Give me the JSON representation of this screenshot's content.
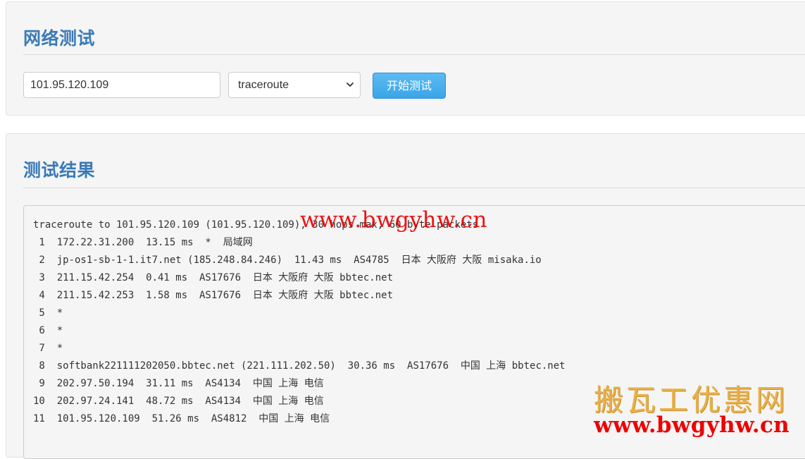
{
  "test_panel": {
    "title": "网络测试",
    "ip_value": "101.95.120.109",
    "mode_selected": "traceroute",
    "start_label": "开始测试"
  },
  "result_panel": {
    "title": "测试结果",
    "lines": [
      "traceroute to 101.95.120.109 (101.95.120.109), 30 hops max, 60 byte packets",
      " 1  172.22.31.200  13.15 ms  *  局域网",
      " 2  jp-os1-sb-1-1.it7.net (185.248.84.246)  11.43 ms  AS4785  日本 大阪府 大阪 misaka.io",
      " 3  211.15.42.254  0.41 ms  AS17676  日本 大阪府 大阪 bbtec.net",
      " 4  211.15.42.253  1.58 ms  AS17676  日本 大阪府 大阪 bbtec.net",
      " 5  *",
      " 6  *",
      " 7  *",
      " 8  softbank221111202050.bbtec.net (221.111.202.50)  30.36 ms  AS17676  中国 上海 bbtec.net",
      " 9  202.97.50.194  31.11 ms  AS4134  中国 上海 电信",
      "10  202.97.24.141  48.72 ms  AS4134  中国 上海 电信",
      "11  101.95.120.109  51.26 ms  AS4812  中国 上海 电信"
    ]
  },
  "watermarks": {
    "url_top": "www.bwgyhw.cn",
    "brand": "搬瓦工优惠网",
    "url_bottom": "www.bwgyhw.cn"
  },
  "colors": {
    "title": "#3a7ab7",
    "button": "#39a5e8",
    "watermark_red": "#ee0000",
    "watermark_gold": "#e8b04a"
  },
  "icons": {
    "select_arrow": "chevron-down-icon"
  }
}
